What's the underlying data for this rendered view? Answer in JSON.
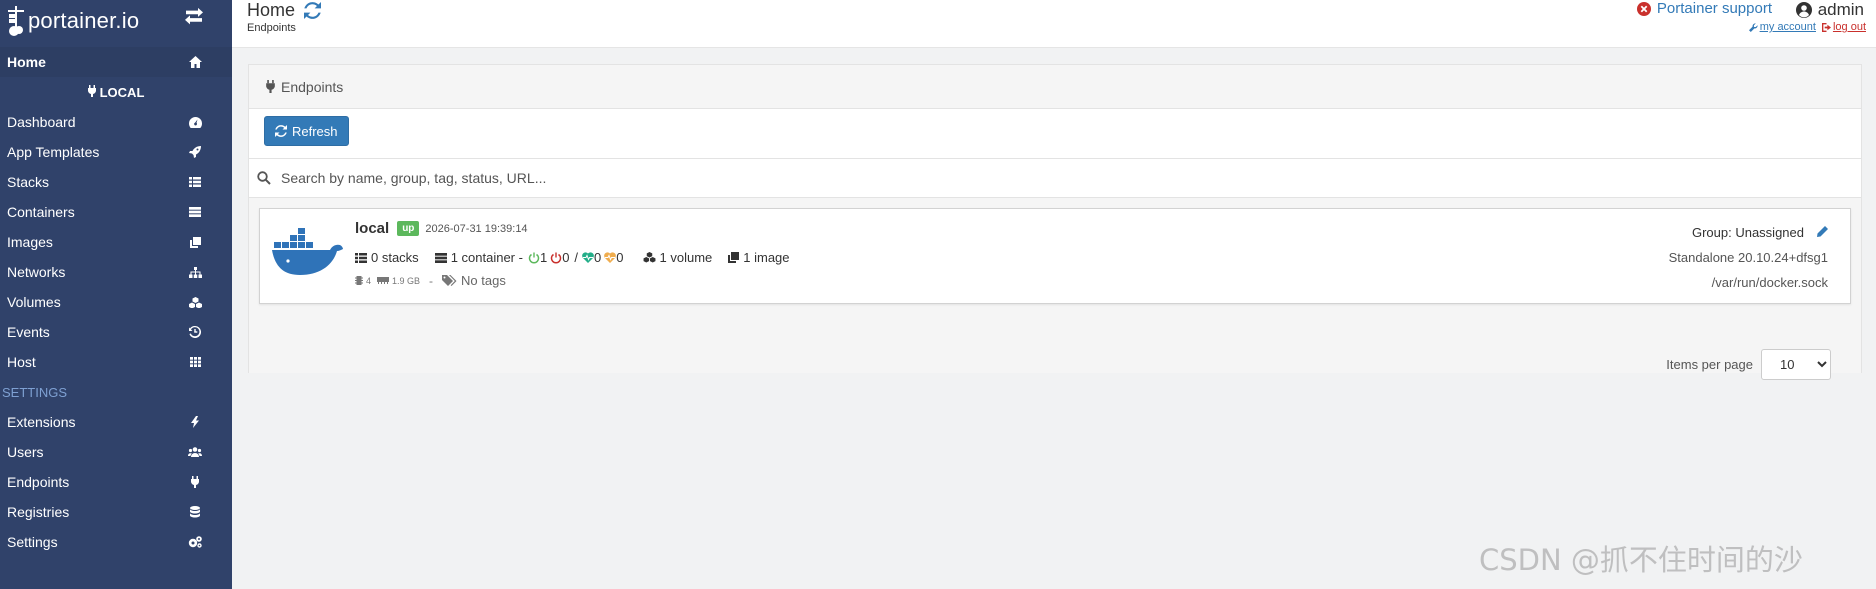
{
  "brand": {
    "name": "portainer.io"
  },
  "sidebar": {
    "home_label": "Home",
    "endpoint_title": "LOCAL",
    "items": [
      {
        "label": "Dashboard",
        "icon": "tachometer-icon"
      },
      {
        "label": "App Templates",
        "icon": "rocket-icon"
      },
      {
        "label": "Stacks",
        "icon": "th-list-icon"
      },
      {
        "label": "Containers",
        "icon": "server-icon"
      },
      {
        "label": "Images",
        "icon": "clone-icon"
      },
      {
        "label": "Networks",
        "icon": "sitemap-icon"
      },
      {
        "label": "Volumes",
        "icon": "cubes-icon"
      },
      {
        "label": "Events",
        "icon": "history-icon"
      },
      {
        "label": "Host",
        "icon": "th-icon"
      }
    ],
    "settings_title": "SETTINGS",
    "settings_items": [
      {
        "label": "Extensions",
        "icon": "bolt-icon"
      },
      {
        "label": "Users",
        "icon": "users-icon"
      },
      {
        "label": "Endpoints",
        "icon": "plug-icon"
      },
      {
        "label": "Registries",
        "icon": "database-icon"
      },
      {
        "label": "Settings",
        "icon": "cogs-icon"
      }
    ]
  },
  "header": {
    "title": "Home",
    "breadcrumb": "Endpoints",
    "support_label": "Portainer support",
    "username": "admin",
    "my_account": "my account",
    "log_out": "log out"
  },
  "panel": {
    "heading": "Endpoints",
    "refresh_label": "Refresh",
    "search_placeholder": "Search by name, group, tag, status, URL..."
  },
  "endpoint": {
    "name": "local",
    "status": "up",
    "timestamp": "2026-07-31 19:39:14",
    "stacks": "0 stacks",
    "containers": "1 container -",
    "running": "1",
    "stopped": "0",
    "slash": "/",
    "healthy": "0",
    "unhealthy": "0",
    "volumes": "1 volume",
    "images": "1 image",
    "cpu": "4",
    "memory": "1.9 GB",
    "separator": "-",
    "tags": "No tags",
    "group": "Group: Unassigned",
    "version": "Standalone 20.10.24+dfsg1",
    "url": "/var/run/docker.sock"
  },
  "pagination": {
    "label": "Items per page",
    "selected": "10"
  },
  "watermark": "CSDN @抓不住时间的沙",
  "colors": {
    "sidebar_bg": "#30426a",
    "primary": "#337ab7",
    "success": "#5cb85c",
    "danger": "#c9302c",
    "warning": "#f0ad4e",
    "healthy": "#23ae89"
  }
}
